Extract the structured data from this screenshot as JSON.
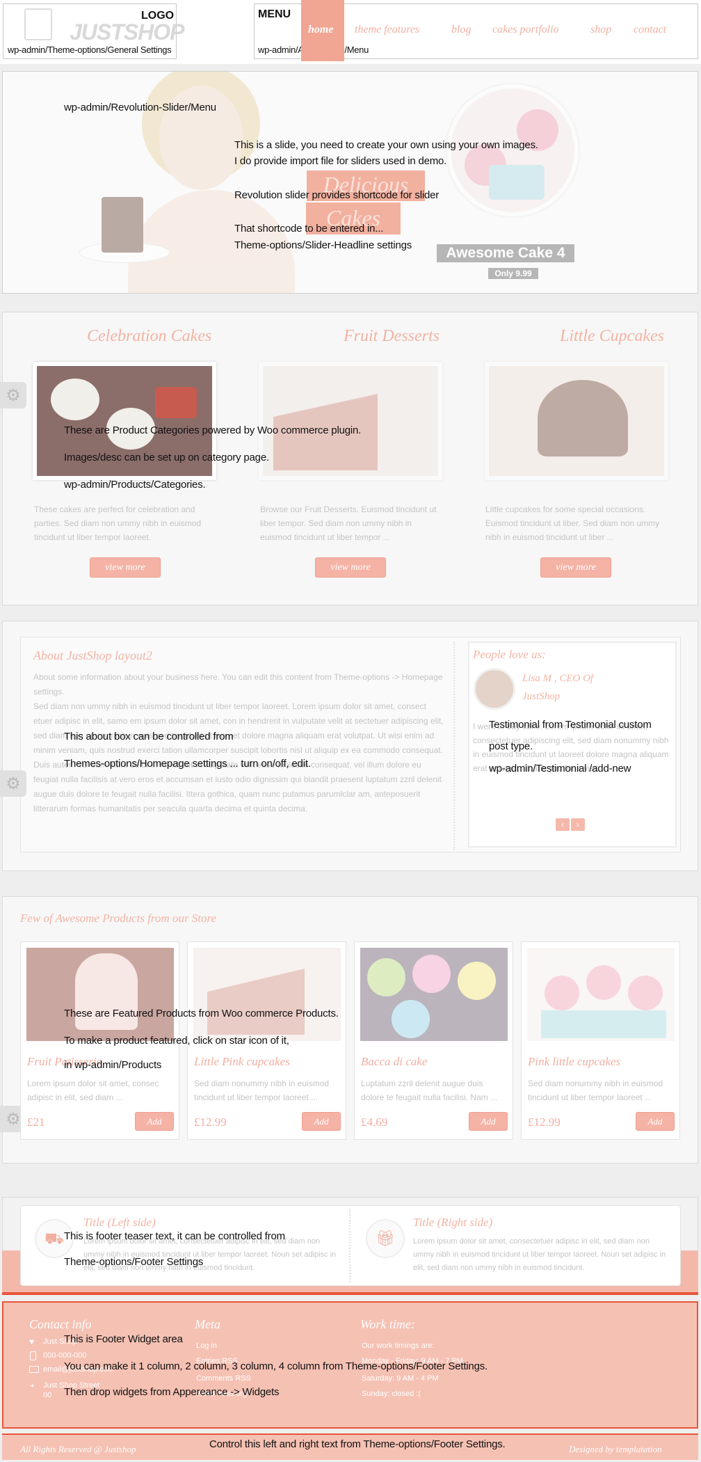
{
  "header": {
    "logo_brand": "JUSTSHOP",
    "logo_label": "LOGO",
    "logo_path": "wp-admin/Theme-options/General Settings",
    "menu_label": "MENU",
    "menu_path": "wp-admin/Appereance/Menu",
    "nav": [
      "home",
      "theme features",
      "blog",
      "cakes portfolio",
      "shop",
      "contact"
    ]
  },
  "slider": {
    "path": "wp-admin/Revolution-Slider/Menu",
    "notes": [
      "This is a slide, you need to create your own using your own images.",
      "I do provide import file for sliders used in demo.",
      "Revolution slider provides shortcode for slider",
      "That shortcode to be entered in...",
      "Theme-options/Slider-Headline settings"
    ],
    "headline_1": "Delicious",
    "headline_2": "Cakes",
    "product_title": "Awesome Cake 4",
    "product_price": "Only 9.99"
  },
  "categories": {
    "items": [
      {
        "title": "Celebration Cakes",
        "desc": "These cakes are perfect for celebration and parties. Sed diam non ummy nibh in euismod tincidunt ut liber tempor laoreet.",
        "button": "view more"
      },
      {
        "title": "Fruit Desserts",
        "desc": "Browse our Fruit Desserts. Euismod tincidunt ut liber tempor. Sed diam non ummy nibh in euismod tincidunt ut liber tempor ...",
        "button": "view more"
      },
      {
        "title": "Little Cupcakes",
        "desc": "Little cupcakes for some special occasions. Euismod tincidunt ut liber. Sed diam non ummy nibh in euismod tincidunt ut liber ...",
        "button": "view more"
      }
    ],
    "notes": [
      "These are Product Categories powered by Woo commerce plugin.",
      "Images/desc can be set up on category page.",
      "wp-admin/Products/Categories."
    ]
  },
  "about": {
    "title": "About JustShop layout2",
    "intro": "About some information about your business here. You can edit this content from Theme-options -> Homepage settings.",
    "body": "Sed diam non ummy nibh in euismod tincidunt ut liber tempor laoreet. Lorem ipsum dolor sit amet, consect etuer adipisc in elit, samo em ipsum dolor sit amet, con in hendrerit in vulputate velit at sectetuer adipiscing elit, sed diam non ummy nibh in euismod tincidunt ut laoreet dolore magna aliquam erat volutpat. Ut wisi enim ad minim veniam, quis nostrud exerci tation ullamcorper suscipit lobortis nisl ut aliquip ex ea commodo consequat. Duis autem vel eum iriure dolor in hendrerit in vulputate velit esse molestie consequat, vel illum dolore eu feugiat nulla facilisis at vero eros et accumsan et iusto odio dignissim qui blandit praesent luptatum zzril delenit augue duis dolore te feugait nulla facilisi. Ittera gothica, quam nunc putamus parumlclar am, anteposuerit litterarum formas humanitatis per seacula quarta decima et quinta decima.",
    "notes": [
      "This about box can be controlled from",
      "Themes-options/Homepage settings ... turn on/off, edit."
    ]
  },
  "testimonial": {
    "heading": "People love us:",
    "author": "Lisa M , CEO Of JustShop",
    "text": "I went to buy cake. Lorem ipsum dolor sit amet, consectetuer adipiscing elit, sed diam nonummy nibh in euismod tincidunt ut laoreet dolore magna aliquam erat volutpat. Thank you for a visit.",
    "notes": [
      "Testimonial from Testimonial custom",
      "post  type.",
      "wp-admin/Testimonial /add-new"
    ]
  },
  "products": {
    "heading": "Few of Awesome Products from our Store",
    "items": [
      {
        "name": "Fruit Patisserie",
        "desc": "Lorem ipsum dolor sit amet, consec adipisc in elit, sed diam ...",
        "price": "£21",
        "button": "Add"
      },
      {
        "name": "Little Pink cupcakes",
        "desc": "Sed diam nonummy nibh in euismod tincidunt ut liber tempor laoreet ...",
        "price": "£12.99",
        "button": "Add"
      },
      {
        "name": "Bacca di cake",
        "desc": "Luptatum zzril delenit augue duis dolore te feugait nulla facilisi. Nam ...",
        "price": "£4.69",
        "button": "Add"
      },
      {
        "name": "Pink little cupcakes",
        "desc": "Sed diam nonummy nibh in euismod tincidunt ut liber tempor laoreet ...",
        "price": "£12.99",
        "button": "Add"
      }
    ],
    "notes": [
      "These are Featured Products from Woo commerce Products.",
      "To make a product featured, click on star icon of it,",
      "in wp-admin/Products"
    ]
  },
  "teaser": {
    "left_title": "Title (Left side)",
    "left_text": "Lorem ipsum dolor sit amet, consectetuer adipisc in elit, sed diam non ummy nibh in euismod tincidunt ut liber tempor laoreet. Noun set adipisc in elit, sed diam non ummy nibh in euismod tincidunt.",
    "right_title": "Title (Right side)",
    "right_text": "Lorem ipsum dolor sit amet, consectetuer adipisc in elit, sed diam non ummy nibh in euismod tincidunt ut liber tempor laoreet. Noun set adipisc in elit, sed diam non ummy nibh in euismod tincidunt.",
    "notes": [
      "This is footer teaser text, it can be controlled from",
      "Theme-options/Footer Settings"
    ]
  },
  "footer": {
    "contact_title": "Contact info",
    "contact_items": [
      "Just Shop",
      "000-000-000",
      "email@justshop.com",
      "Just Shop Street 00"
    ],
    "meta_title": "Meta",
    "meta_items": [
      "Log in",
      "Entries RSS",
      "Comments RSS",
      "WordPress.org"
    ],
    "work_title": "Work time:",
    "work_items": [
      "Our work timings are:",
      "Monday - Friday: 9 AM - 7 PM",
      "Saturday: 9 AM - 4 PM",
      "Sunday: closed :("
    ],
    "notes": [
      "This is Footer Widget area",
      "You can make it 1 column, 2 column, 3 column, 4 column from Theme-options/Footer Settings.",
      "Then drop widgets from Appereance -> Widgets"
    ],
    "bottom_left": "All Rights Reserved @ Justshop",
    "bottom_note": "Control this left and right text from Theme-options/Footer Settings.",
    "bottom_right": "Designed by templatation"
  },
  "colors": {
    "accent": "#f3b3a3",
    "accent_strong": "#e8553a",
    "footer_bg": "#f5c1b3"
  }
}
